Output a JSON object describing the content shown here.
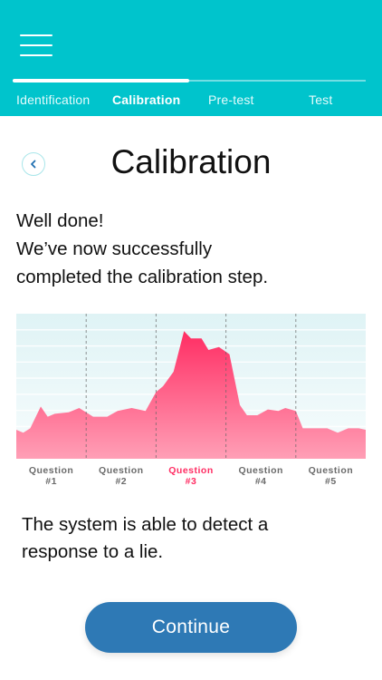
{
  "header": {
    "menu_icon": "hamburger-menu-icon",
    "background_color": "#00c4cc",
    "progress_fraction": 0.5,
    "steps": [
      {
        "label": "Identification",
        "active": false
      },
      {
        "label": "Calibration",
        "active": true
      },
      {
        "label": "Pre-test",
        "active": false
      },
      {
        "label": "Test",
        "active": false
      }
    ]
  },
  "main": {
    "back_icon": "chevron-left-icon",
    "title": "Calibration",
    "message_line_1": "Well done!",
    "message_line_2": "We’ve now successfully",
    "message_line_3": "completed the calibration step.",
    "result_line_1": "The system is able to detect a",
    "result_line_2": "response to a lie.",
    "continue_label": "Continue",
    "button_color": "#2e79b5"
  },
  "chart_data": {
    "type": "area",
    "title": "",
    "xlabel": "",
    "ylabel": "",
    "grid": true,
    "fill_color": "#ff2d63",
    "highlight_color": "#ff2d63",
    "x_range": [
      0,
      5
    ],
    "ylim": [
      0,
      1
    ],
    "categories": [
      {
        "line1": "Question",
        "line2": "#1",
        "highlight": false
      },
      {
        "line1": "Question",
        "line2": "#2",
        "highlight": false
      },
      {
        "line1": "Question",
        "line2": "#3",
        "highlight": true
      },
      {
        "line1": "Question",
        "line2": "#4",
        "highlight": false
      },
      {
        "line1": "Question",
        "line2": "#5",
        "highlight": false
      }
    ],
    "x": [
      0,
      0.1,
      0.2,
      0.35,
      0.45,
      0.55,
      0.75,
      0.9,
      1.1,
      1.3,
      1.45,
      1.65,
      1.85,
      2.0,
      2.1,
      2.25,
      2.4,
      2.5,
      2.65,
      2.75,
      2.9,
      3.05,
      3.2,
      3.3,
      3.45,
      3.6,
      3.75,
      3.85,
      4.0,
      4.1,
      4.3,
      4.45,
      4.6,
      4.75,
      4.9,
      5.0
    ],
    "values": [
      0.2,
      0.18,
      0.21,
      0.36,
      0.29,
      0.31,
      0.32,
      0.35,
      0.29,
      0.29,
      0.33,
      0.35,
      0.33,
      0.46,
      0.5,
      0.6,
      0.88,
      0.83,
      0.83,
      0.75,
      0.77,
      0.72,
      0.37,
      0.3,
      0.3,
      0.34,
      0.33,
      0.35,
      0.33,
      0.21,
      0.21,
      0.21,
      0.18,
      0.21,
      0.21,
      0.2
    ]
  }
}
